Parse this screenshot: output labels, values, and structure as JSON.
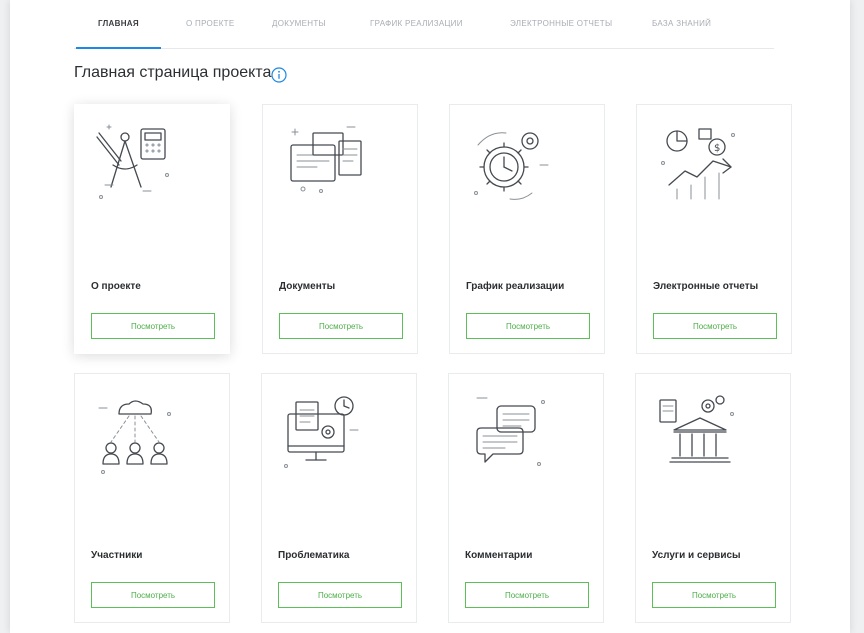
{
  "tabs": [
    {
      "label": "ГЛАВНАЯ",
      "active": true
    },
    {
      "label": "О ПРОЕКТЕ",
      "active": false
    },
    {
      "label": "ДОКУМЕНТЫ",
      "active": false
    },
    {
      "label": "ГРАФИК РЕАЛИЗАЦИИ",
      "active": false
    },
    {
      "label": "ЭЛЕКТРОННЫЕ ОТЧЕТЫ",
      "active": false
    },
    {
      "label": "БАЗА ЗНАНИЙ",
      "active": false
    }
  ],
  "page": {
    "title": "Главная страница проекта",
    "info_icon": "info-icon"
  },
  "cards": [
    {
      "title": "О проекте",
      "button": "Посмотреть",
      "icon": "compass-calculator-icon",
      "highlighted": true
    },
    {
      "title": "Документы",
      "button": "Посмотреть",
      "icon": "documents-icon",
      "highlighted": false
    },
    {
      "title": "График реализации",
      "button": "Посмотреть",
      "icon": "gears-clock-icon",
      "highlighted": false
    },
    {
      "title": "Электронные отчеты",
      "button": "Посмотреть",
      "icon": "chart-report-icon",
      "highlighted": false
    },
    {
      "title": "Участники",
      "button": "Посмотреть",
      "icon": "cloud-users-icon",
      "highlighted": false
    },
    {
      "title": "Проблематика",
      "button": "Посмотреть",
      "icon": "monitor-problems-icon",
      "highlighted": false
    },
    {
      "title": "Комментарии",
      "button": "Посмотреть",
      "icon": "chat-bubbles-icon",
      "highlighted": false
    },
    {
      "title": "Услуги и сервисы",
      "button": "Посмотреть",
      "icon": "bank-services-icon",
      "highlighted": false
    }
  ],
  "colors": {
    "accent_tab": "#1e88e5",
    "button_border": "#5cbf57",
    "button_text": "#4cae47",
    "info_icon": "#1e88e5"
  }
}
